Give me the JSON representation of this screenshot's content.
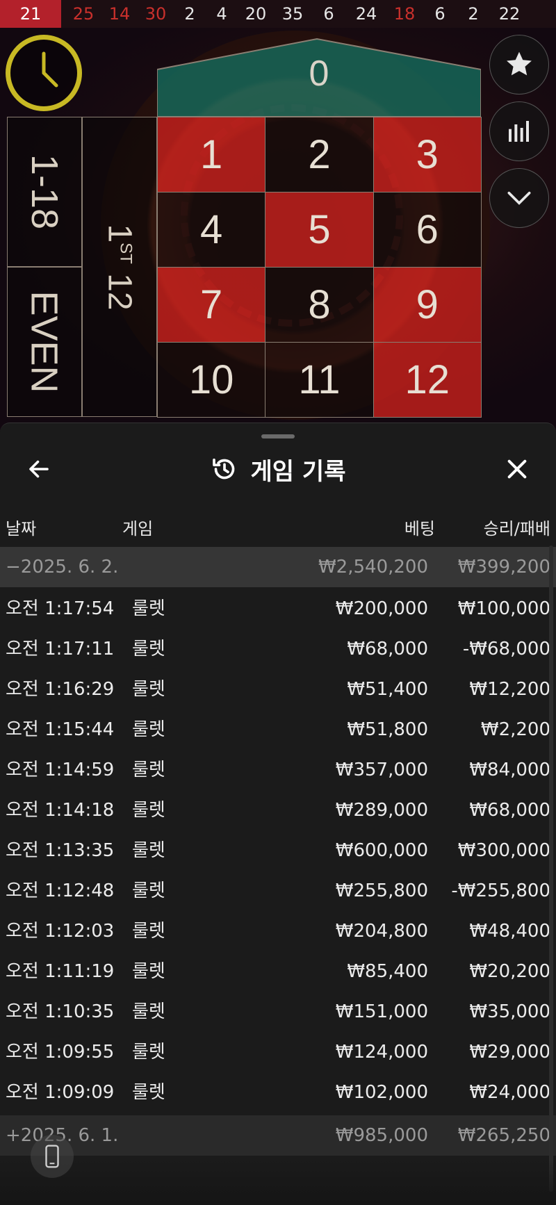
{
  "results": [
    {
      "n": "21",
      "color": "red",
      "latest": true
    },
    {
      "n": "25",
      "color": "red"
    },
    {
      "n": "14",
      "color": "red"
    },
    {
      "n": "30",
      "color": "red"
    },
    {
      "n": "2",
      "color": "black"
    },
    {
      "n": "4",
      "color": "black"
    },
    {
      "n": "20",
      "color": "black"
    },
    {
      "n": "35",
      "color": "black"
    },
    {
      "n": "6",
      "color": "black"
    },
    {
      "n": "24",
      "color": "black"
    },
    {
      "n": "18",
      "color": "red"
    },
    {
      "n": "6",
      "color": "black"
    },
    {
      "n": "2",
      "color": "black"
    },
    {
      "n": "22",
      "color": "black"
    }
  ],
  "table": {
    "zero": "0",
    "cells": [
      {
        "n": "1",
        "color": "red"
      },
      {
        "n": "2",
        "color": "black"
      },
      {
        "n": "3",
        "color": "red"
      },
      {
        "n": "4",
        "color": "black"
      },
      {
        "n": "5",
        "color": "red"
      },
      {
        "n": "6",
        "color": "black"
      },
      {
        "n": "7",
        "color": "red"
      },
      {
        "n": "8",
        "color": "black"
      },
      {
        "n": "9",
        "color": "red"
      },
      {
        "n": "10",
        "color": "black"
      },
      {
        "n": "11",
        "color": "black"
      },
      {
        "n": "12",
        "color": "red"
      }
    ],
    "outside_low": "1-18",
    "outside_even": "EVEN",
    "dozen_prefix": "1",
    "dozen_suffix": "ST",
    "dozen_number": "12"
  },
  "side_buttons": {
    "favorite": "star-icon",
    "stats": "statistics-icon",
    "collapse": "chevron-down-icon"
  },
  "history": {
    "title": "게임 기록",
    "columns": {
      "date": "날짜",
      "game": "게임",
      "bet": "베팅",
      "winloss": "승리/패배"
    },
    "groups": [
      {
        "label": "−2025. 6. 2.",
        "bet": "₩2,540,200",
        "winloss": "₩399,200",
        "expanded": true,
        "rows": [
          {
            "time": "오전 1:17:54",
            "game": "룰렛",
            "bet": "₩200,000",
            "winloss": "₩100,000"
          },
          {
            "time": "오전 1:17:11",
            "game": "룰렛",
            "bet": "₩68,000",
            "winloss": "-₩68,000"
          },
          {
            "time": "오전 1:16:29",
            "game": "룰렛",
            "bet": "₩51,400",
            "winloss": "₩12,200"
          },
          {
            "time": "오전 1:15:44",
            "game": "룰렛",
            "bet": "₩51,800",
            "winloss": "₩2,200"
          },
          {
            "time": "오전 1:14:59",
            "game": "룰렛",
            "bet": "₩357,000",
            "winloss": "₩84,000"
          },
          {
            "time": "오전 1:14:18",
            "game": "룰렛",
            "bet": "₩289,000",
            "winloss": "₩68,000"
          },
          {
            "time": "오전 1:13:35",
            "game": "룰렛",
            "bet": "₩600,000",
            "winloss": "₩300,000"
          },
          {
            "time": "오전 1:12:48",
            "game": "룰렛",
            "bet": "₩255,800",
            "winloss": "-₩255,800"
          },
          {
            "time": "오전 1:12:03",
            "game": "룰렛",
            "bet": "₩204,800",
            "winloss": "₩48,400"
          },
          {
            "time": "오전 1:11:19",
            "game": "룰렛",
            "bet": "₩85,400",
            "winloss": "₩20,200"
          },
          {
            "time": "오전 1:10:35",
            "game": "룰렛",
            "bet": "₩151,000",
            "winloss": "₩35,000"
          },
          {
            "time": "오전 1:09:55",
            "game": "룰렛",
            "bet": "₩124,000",
            "winloss": "₩29,000"
          },
          {
            "time": "오전 1:09:09",
            "game": "룰렛",
            "bet": "₩102,000",
            "winloss": "₩24,000"
          }
        ]
      },
      {
        "label": "+2025. 6. 1.",
        "bet": "₩985,000",
        "winloss": "₩265,250",
        "expanded": false
      }
    ]
  },
  "colors": {
    "red": "#c4201c",
    "accent_timer": "#c8b924",
    "sheet_bg": "#1b1b1b"
  }
}
